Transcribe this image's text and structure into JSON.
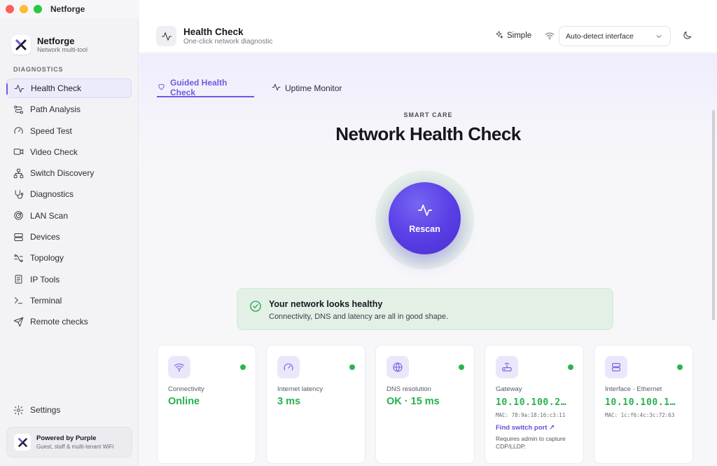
{
  "window": {
    "title": "Netforge"
  },
  "sidebar": {
    "brand_name": "Netforge",
    "brand_sub": "Network multi-tool",
    "section_label": "DIAGNOSTICS",
    "items": [
      {
        "label": "Health Check",
        "icon": "pulse-icon",
        "active": true
      },
      {
        "label": "Path Analysis",
        "icon": "route-icon"
      },
      {
        "label": "Speed Test",
        "icon": "gauge-icon"
      },
      {
        "label": "Video Check",
        "icon": "video-icon"
      },
      {
        "label": "Switch Discovery",
        "icon": "network-icon"
      },
      {
        "label": "Diagnostics",
        "icon": "stethoscope-icon"
      },
      {
        "label": "LAN Scan",
        "icon": "radar-icon"
      },
      {
        "label": "Devices",
        "icon": "server-icon"
      },
      {
        "label": "Topology",
        "icon": "topology-icon"
      },
      {
        "label": "IP Tools",
        "icon": "document-icon"
      },
      {
        "label": "Terminal",
        "icon": "terminal-icon"
      },
      {
        "label": "Remote checks",
        "icon": "send-icon"
      }
    ],
    "settings_label": "Settings",
    "powered_title": "Powered by Purple",
    "powered_sub": "Guest, staff & multi-tenant WiFi"
  },
  "header": {
    "title": "Health Check",
    "subtitle": "One-click network diagnostic",
    "mode_label": "Simple",
    "interface_select": "Auto-detect interface"
  },
  "main": {
    "tabs": [
      {
        "label": "Guided Health Check",
        "active": true
      },
      {
        "label": "Uptime Monitor",
        "active": false
      }
    ],
    "eyebrow": "SMART CARE",
    "title": "Network Health Check",
    "scan_button": "Rescan",
    "banner": {
      "title": "Your network looks healthy",
      "text": "Connectivity, DNS and latency are all in good shape."
    },
    "cards": [
      {
        "label": "Connectivity",
        "value": "Online",
        "icon": "wifi-icon",
        "status": "ok"
      },
      {
        "label": "Internet latency",
        "value": "3 ms",
        "icon": "gauge-icon",
        "status": "ok"
      },
      {
        "label": "DNS resolution",
        "value": "OK · 15 ms",
        "icon": "globe-icon",
        "status": "ok"
      },
      {
        "label": "Gateway",
        "value": "10.10.100.2…",
        "mac": "MAC: 78:9a:18:16:c3:11",
        "link": "Find switch port ↗",
        "note": "Requires admin to capture CDP/LLDP.",
        "icon": "router-icon",
        "status": "ok"
      },
      {
        "label": "Interface · Ethernet",
        "value": "10.10.100.1…",
        "mac": "MAC: 1c:f6:4c:3c:72:63",
        "icon": "ethernet-icon",
        "status": "ok"
      }
    ]
  },
  "colors": {
    "accent": "#6b5ce0",
    "success": "#26b04d",
    "banner_bg": "#e2f0e6"
  }
}
